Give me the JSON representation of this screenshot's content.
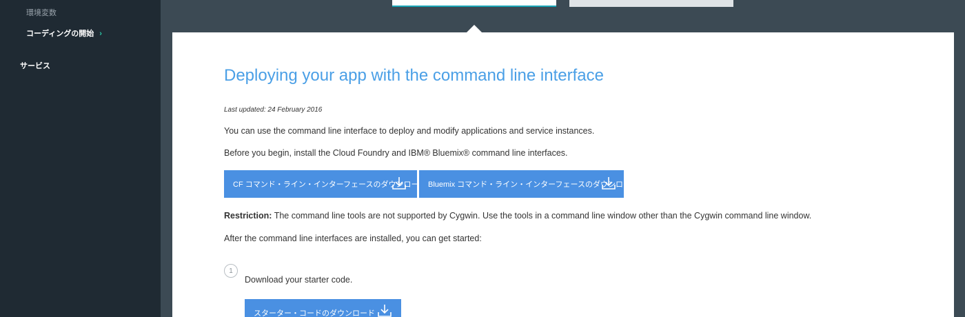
{
  "sidebar": {
    "items": [
      {
        "label": "環境変数"
      },
      {
        "label": "コーディングの開始",
        "chevron": "›"
      },
      {
        "label": "サービス"
      }
    ]
  },
  "content": {
    "title": "Deploying your app with the command line interface",
    "last_updated": "Last updated: 24 February 2016",
    "intro": "You can use the command line interface to deploy and modify applications and service instances.",
    "before_begin": "Before you begin, install the Cloud Foundry and IBM® Bluemix® command line interfaces.",
    "buttons": {
      "cf_download": "CF コマンド・ライン・インターフェースのダウンロード",
      "bluemix_download": "Bluemix コマンド・ライン・インターフェースのダウンロード"
    },
    "restriction_label": "Restriction:",
    "restriction_text": " The command line tools are not supported by Cygwin. Use the tools in a command line window other than the Cygwin command line window.",
    "after_install": "After the command line interfaces are installed, you can get started:",
    "steps": [
      {
        "number": "1",
        "text": "Download your starter code.",
        "button": "スターター・コードのダウンロード"
      }
    ]
  },
  "icons": {
    "download": "download-icon",
    "step": "step-number"
  },
  "colors": {
    "accent_blue": "#4a90e2",
    "title_blue": "#4a9fe6",
    "sidebar_bg": "#1f2a33",
    "page_bg": "#3c4a54",
    "chevron_green": "#2bc9a8"
  }
}
